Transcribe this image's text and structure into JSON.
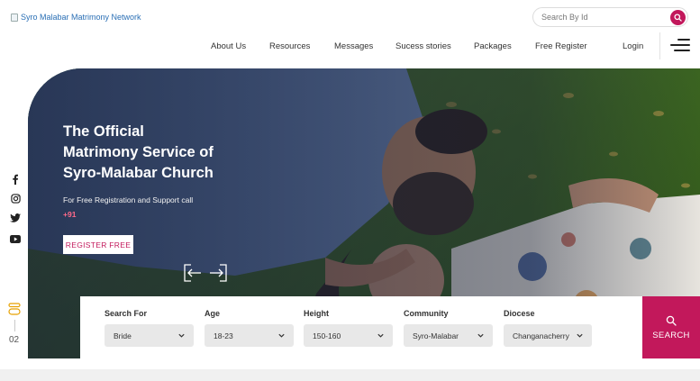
{
  "logo": {
    "alt_text": "Syro Malabar Matrimony Network"
  },
  "search": {
    "placeholder": "Search By Id"
  },
  "nav": {
    "items": [
      "About Us",
      "Resources",
      "Messages",
      "Sucess stories",
      "Packages",
      "Free Register",
      "Login"
    ]
  },
  "hero": {
    "title": "The Official Matrimony Service of Syro-Malabar Church",
    "subtitle": "For Free Registration and Support call",
    "phone": "+91",
    "register_label": "REGISTER FREE"
  },
  "slider": {
    "current": "02"
  },
  "search_panel": {
    "fields": [
      {
        "label": "Search For",
        "value": "Bride"
      },
      {
        "label": "Age",
        "value": "18-23"
      },
      {
        "label": "Height",
        "value": "150-160"
      },
      {
        "label": "Community",
        "value": "Syro-Malabar"
      },
      {
        "label": "Diocese",
        "value": "Changanacherry"
      }
    ],
    "button_label": "SEARCH"
  },
  "colors": {
    "accent": "#c2185b",
    "phone": "#ff6a8a"
  },
  "icons": [
    "search-icon",
    "menu-icon",
    "facebook-icon",
    "instagram-icon",
    "twitter-icon",
    "youtube-icon",
    "arrow-left-icon",
    "arrow-right-icon",
    "chevron-down-icon"
  ]
}
